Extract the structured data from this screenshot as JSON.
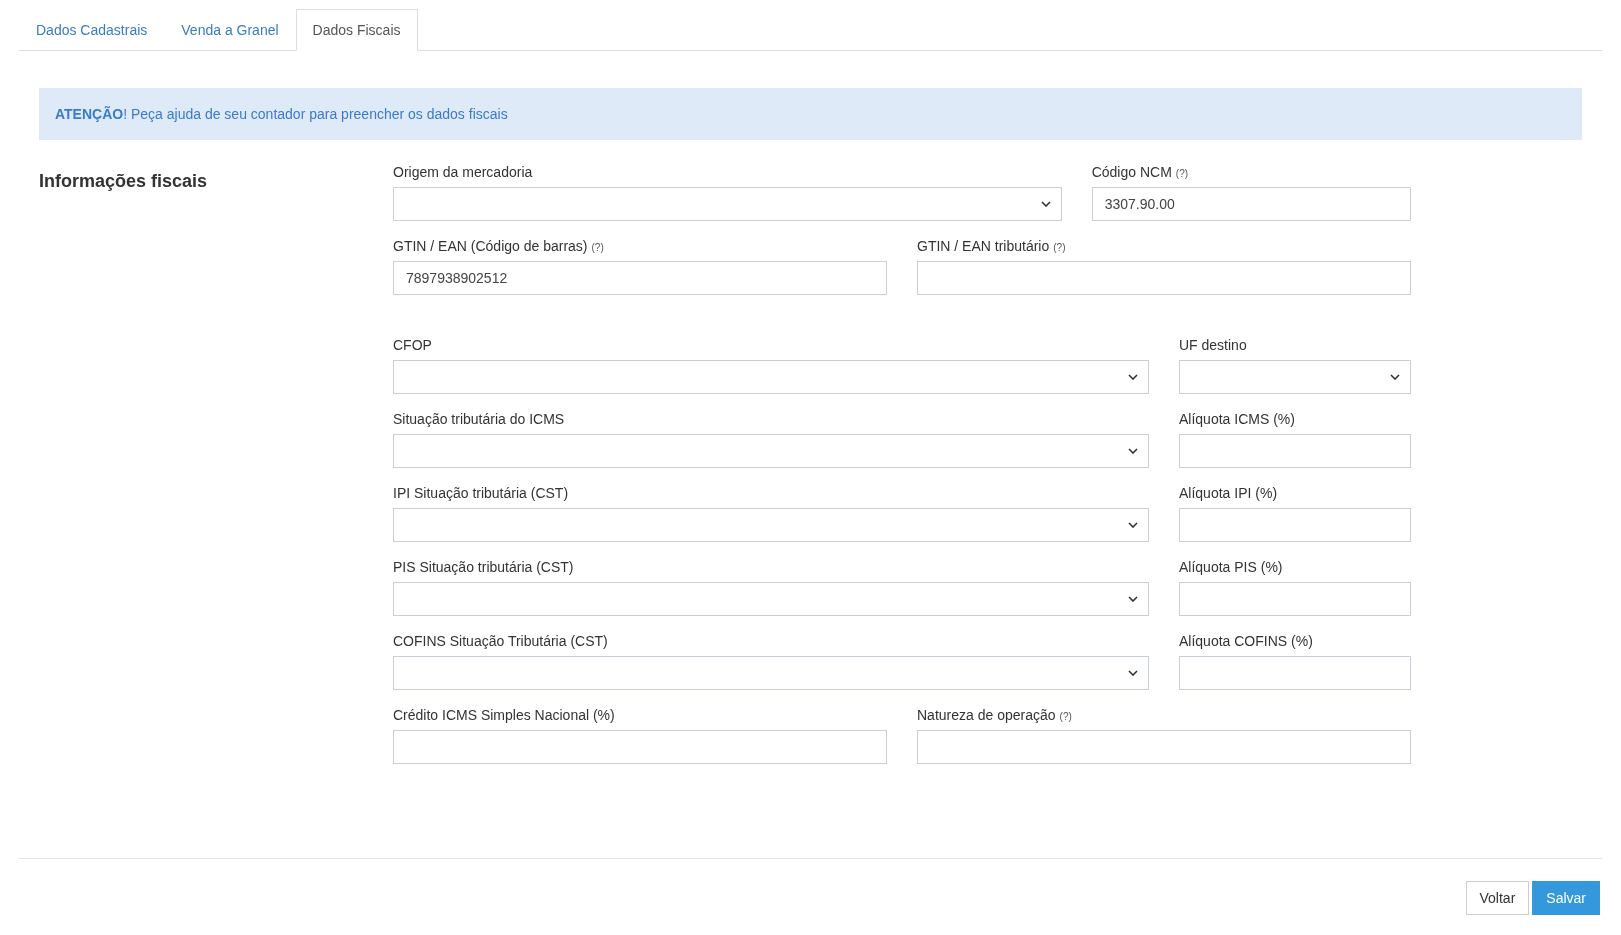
{
  "tabs": [
    {
      "label": "Dados Cadastrais",
      "selected": false
    },
    {
      "label": "Venda a Granel",
      "selected": false
    },
    {
      "label": "Dados Fiscais",
      "selected": true
    }
  ],
  "alert": "**ATENÇÃO**! Peça ajuda de seu contador para preencher os dados fiscais",
  "section_title": "Informações fiscais",
  "groups": [
    [
      [
        {
          "label": "Origem da mercadoria",
          "kind": "select"
        },
        {
          "label": "Código NCM",
          "help": "(?)",
          "kind": "text",
          "value": "3307.90.00"
        }
      ],
      [
        {
          "label": "GTIN / EAN (Código de barras)",
          "help": "(?)",
          "kind": "text",
          "value": "7897938902512"
        },
        {
          "label": "GTIN / EAN tributário",
          "help": "(?)",
          "kind": "text"
        }
      ]
    ],
    [
      [
        {
          "label": "CFOP",
          "kind": "select"
        },
        {
          "label": "UF destino",
          "kind": "select"
        }
      ],
      [
        {
          "label": "Situação tributária do ICMS",
          "kind": "select"
        },
        {
          "label": "Alíquota ICMS (%)",
          "kind": "text"
        }
      ],
      [
        {
          "label": "IPI Situação tributária (CST)",
          "kind": "select"
        },
        {
          "label": "Alíquota IPI (%)",
          "kind": "text"
        }
      ],
      [
        {
          "label": "PIS Situação tributária (CST)",
          "kind": "select"
        },
        {
          "label": "Alíquota PIS (%)",
          "kind": "text"
        }
      ],
      [
        {
          "label": "COFINS Situação Tributária (CST)",
          "kind": "select"
        },
        {
          "label": "Alíquota COFINS (%)",
          "kind": "text"
        }
      ],
      [
        {
          "label": "Crédito ICMS Simples Nacional (%)",
          "kind": "text"
        },
        {
          "label": "Natureza de operação",
          "help": "(?)",
          "kind": "text"
        }
      ]
    ]
  ],
  "buttons": [
    {
      "label": "Voltar",
      "kind": "secondary"
    },
    {
      "label": "Salvar",
      "kind": "primary"
    }
  ]
}
